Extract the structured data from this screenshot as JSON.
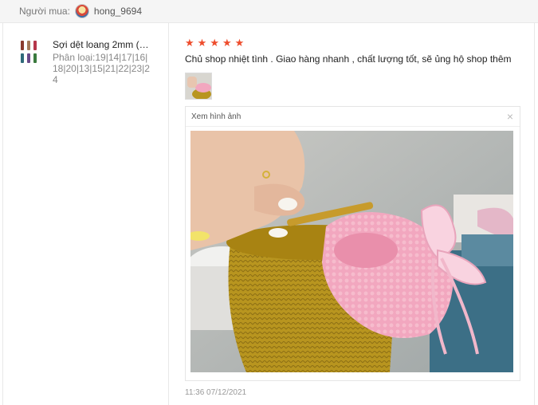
{
  "buyer": {
    "label": "Người mua:",
    "avatar_icon": "buyer-avatar",
    "username": "hong_9694"
  },
  "product": {
    "thumb_icon": "yarn-spools-thumbnail",
    "name": "Sợi dệt loang 2mm (…",
    "variant": "Phân loại:19|14|17|16|18|20|13|15|21|22|23|24"
  },
  "review": {
    "rating": 5,
    "star_icon": "star-icon",
    "stars": [
      "★",
      "★",
      "★",
      "★",
      "★"
    ],
    "text": "Chủ shop nhiệt tình . Giao hàng nhanh , chất lượng tốt, sẽ ủng hộ shop thêm",
    "viewer_title": "Xem hình ảnh",
    "close_glyph": "×",
    "timestamp": "11:36 07/12/2021"
  },
  "colors": {
    "star": "#ee4d2d",
    "yarn_gold": "#b8951f",
    "yarn_pink": "#f2a7bf"
  }
}
